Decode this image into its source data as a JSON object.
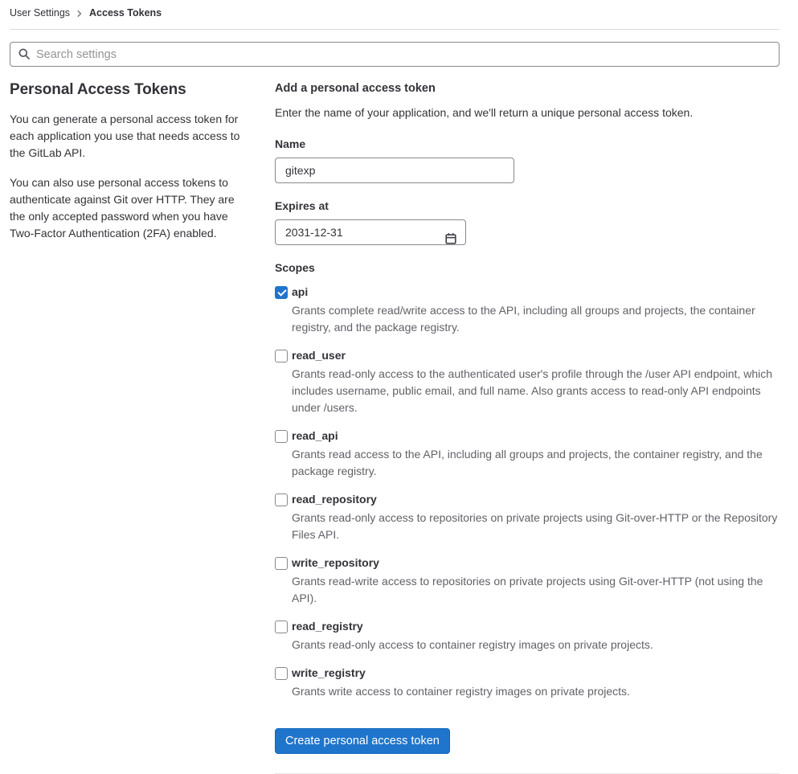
{
  "breadcrumb": {
    "items": [
      {
        "label": "User Settings"
      },
      {
        "label": "Access Tokens"
      }
    ],
    "chevron_icon": "chevron-right-icon"
  },
  "search": {
    "placeholder": "Search settings",
    "icon": "search-icon"
  },
  "sidebar": {
    "title": "Personal Access Tokens",
    "paragraphs": [
      "You can generate a personal access token for each application you use that needs access to the GitLab API.",
      "You can also use personal access tokens to authenticate against Git over HTTP. They are the only accepted password when you have Two-Factor Authentication (2FA) enabled."
    ]
  },
  "form": {
    "title": "Add a personal access token",
    "subtitle": "Enter the name of your application, and we'll return a unique personal access token.",
    "name_field": {
      "label": "Name",
      "value": "gitexp"
    },
    "expires_field": {
      "label": "Expires at",
      "value": "2031-12-31",
      "icon": "calendar-icon"
    },
    "scopes": {
      "label": "Scopes",
      "items": [
        {
          "label": "api",
          "checked": true,
          "description": "Grants complete read/write access to the API, including all groups and projects, the container registry, and the package registry."
        },
        {
          "label": "read_user",
          "checked": false,
          "description": "Grants read-only access to the authenticated user's profile through the /user API endpoint, which includes username, public email, and full name. Also grants access to read-only API endpoints under /users."
        },
        {
          "label": "read_api",
          "checked": false,
          "description": "Grants read access to the API, including all groups and projects, the container registry, and the package registry."
        },
        {
          "label": "read_repository",
          "checked": false,
          "description": "Grants read-only access to repositories on private projects using Git-over-HTTP or the Repository Files API."
        },
        {
          "label": "write_repository",
          "checked": false,
          "description": "Grants read-write access to repositories on private projects using Git-over-HTTP (not using the API)."
        },
        {
          "label": "read_registry",
          "checked": false,
          "description": "Grants read-only access to container registry images on private projects."
        },
        {
          "label": "write_registry",
          "checked": false,
          "description": "Grants write access to container registry images on private projects."
        }
      ]
    },
    "submit_label": "Create personal access token"
  },
  "colors": {
    "accent": "#1f75cb",
    "text": "#333238",
    "secondary_text": "#626168",
    "input_border": "#89888d",
    "divider": "#dcdcde"
  }
}
